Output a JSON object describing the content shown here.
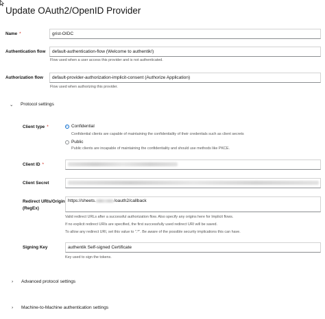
{
  "page": {
    "title": "Update OAuth2/OpenID Provider"
  },
  "form": {
    "name": {
      "label": "Name",
      "value": "grist-OIDC"
    },
    "authentication_flow": {
      "label": "Authentication flow",
      "value": "default-authentication-flow (Welcome to authentik!)",
      "help": "Flow used when a user access this provider and is not authenticated."
    },
    "authorization_flow": {
      "label": "Authorization flow",
      "value": "default-provider-authorization-implicit-consent (Authorize Application)",
      "help": "Flow used when authorizing this provider."
    },
    "required_marker": "*"
  },
  "protocol_settings": {
    "title": "Protocol settings",
    "client_type": {
      "label": "Client type",
      "options": [
        {
          "label": "Confidential",
          "selected": true,
          "help": "Confidential clients are capable of maintaining the confidentiality of their credentials such as client secrets"
        },
        {
          "label": "Public",
          "selected": false,
          "help": "Public clients are incapable of maintaining the confidentiality and should use methods like PKCE."
        }
      ]
    },
    "client_id": {
      "label": "Client ID"
    },
    "client_secret": {
      "label": "Client Secret"
    },
    "redirect_uris": {
      "label_line1": "Redirect URIs/Origins",
      "label_line2": "(RegEx)",
      "value_prefix": "https://sheets.",
      "value_suffix": "/oauth2/callback",
      "help_line1": "Valid redirect URLs after a successful authorization flow. Also specify any origins here for Implicit flows.",
      "help_line2": "If no explicit redirect URIs are specified, the first successfully used redirect URI will be saved.",
      "help_line3": "To allow any redirect URI, set this value to \".*\". Be aware of the possible security implications this can have."
    },
    "signing_key": {
      "label": "Signing Key",
      "value": "authentik Self-signed Certificate",
      "help": "Key used to sign the tokens."
    }
  },
  "collapsed_sections": [
    {
      "title": "Advanced protocol settings"
    },
    {
      "title": "Machine-to-Machine authentication settings"
    }
  ],
  "colors": {
    "accent": "#0066cc",
    "required": "#c9190b",
    "border": "#d2d2d2"
  },
  "icons": {
    "expanded": "chevron-down-icon",
    "collapsed": "chevron-right-icon"
  }
}
